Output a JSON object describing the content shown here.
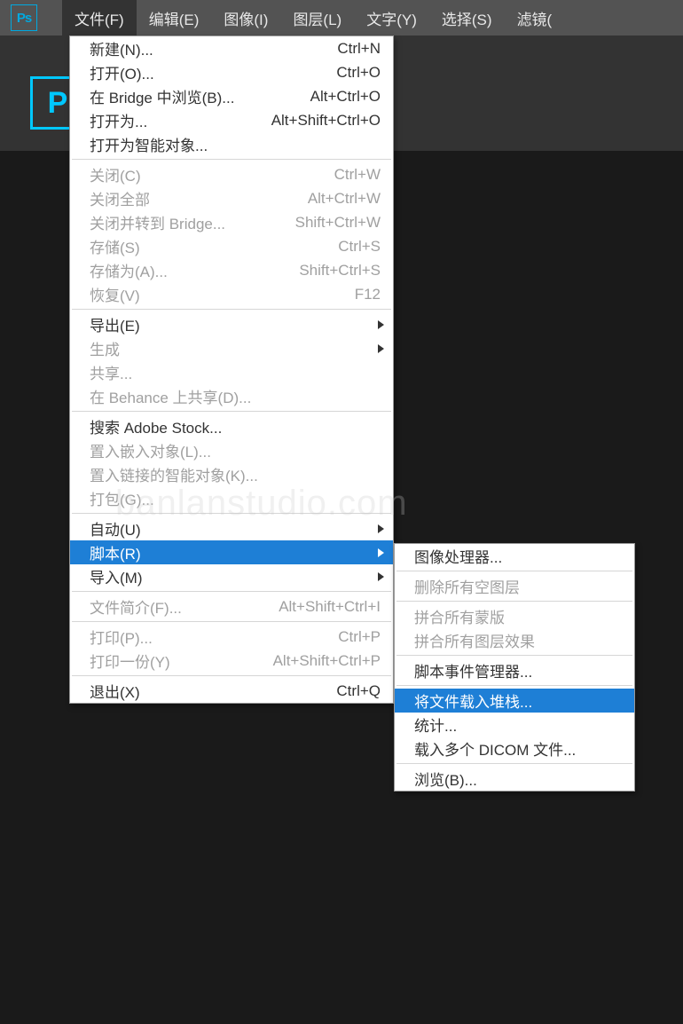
{
  "app": {
    "logo": "Ps",
    "doc_logo": "P"
  },
  "menubar": {
    "items": [
      {
        "label": "文件(F)",
        "active": true
      },
      {
        "label": "编辑(E)"
      },
      {
        "label": "图像(I)"
      },
      {
        "label": "图层(L)"
      },
      {
        "label": "文字(Y)"
      },
      {
        "label": "选择(S)"
      },
      {
        "label": "滤镜("
      }
    ]
  },
  "file_menu": {
    "groups": [
      [
        {
          "label": "新建(N)...",
          "shortcut": "Ctrl+N"
        },
        {
          "label": "打开(O)...",
          "shortcut": "Ctrl+O"
        },
        {
          "label": "在 Bridge 中浏览(B)...",
          "shortcut": "Alt+Ctrl+O"
        },
        {
          "label": "打开为...",
          "shortcut": "Alt+Shift+Ctrl+O"
        },
        {
          "label": "打开为智能对象..."
        }
      ],
      [
        {
          "label": "关闭(C)",
          "shortcut": "Ctrl+W",
          "disabled": true
        },
        {
          "label": "关闭全部",
          "shortcut": "Alt+Ctrl+W",
          "disabled": true
        },
        {
          "label": "关闭并转到 Bridge...",
          "shortcut": "Shift+Ctrl+W",
          "disabled": true
        },
        {
          "label": "存储(S)",
          "shortcut": "Ctrl+S",
          "disabled": true
        },
        {
          "label": "存储为(A)...",
          "shortcut": "Shift+Ctrl+S",
          "disabled": true
        },
        {
          "label": "恢复(V)",
          "shortcut": "F12",
          "disabled": true
        }
      ],
      [
        {
          "label": "导出(E)",
          "submenu": true
        },
        {
          "label": "生成",
          "submenu": true,
          "disabled": true
        },
        {
          "label": "共享...",
          "disabled": true
        },
        {
          "label": "在 Behance 上共享(D)...",
          "disabled": true
        }
      ],
      [
        {
          "label": "搜索 Adobe Stock..."
        },
        {
          "label": "置入嵌入对象(L)...",
          "disabled": true
        },
        {
          "label": "置入链接的智能对象(K)...",
          "disabled": true
        },
        {
          "label": "打包(G)...",
          "disabled": true
        }
      ],
      [
        {
          "label": "自动(U)",
          "submenu": true
        },
        {
          "label": "脚本(R)",
          "submenu": true,
          "highlighted": true
        },
        {
          "label": "导入(M)",
          "submenu": true
        }
      ],
      [
        {
          "label": "文件简介(F)...",
          "shortcut": "Alt+Shift+Ctrl+I",
          "disabled": true
        }
      ],
      [
        {
          "label": "打印(P)...",
          "shortcut": "Ctrl+P",
          "disabled": true
        },
        {
          "label": "打印一份(Y)",
          "shortcut": "Alt+Shift+Ctrl+P",
          "disabled": true
        }
      ],
      [
        {
          "label": "退出(X)",
          "shortcut": "Ctrl+Q"
        }
      ]
    ]
  },
  "script_submenu": {
    "groups": [
      [
        {
          "label": "图像处理器..."
        }
      ],
      [
        {
          "label": "删除所有空图层",
          "disabled": true
        }
      ],
      [
        {
          "label": "拼合所有蒙版",
          "disabled": true
        },
        {
          "label": "拼合所有图层效果",
          "disabled": true
        }
      ],
      [
        {
          "label": "脚本事件管理器..."
        }
      ],
      [
        {
          "label": "将文件载入堆栈...",
          "highlighted": true
        },
        {
          "label": "统计..."
        },
        {
          "label": "载入多个 DICOM 文件..."
        }
      ],
      [
        {
          "label": "浏览(B)..."
        }
      ]
    ]
  },
  "watermark": "banlanstudio.com"
}
